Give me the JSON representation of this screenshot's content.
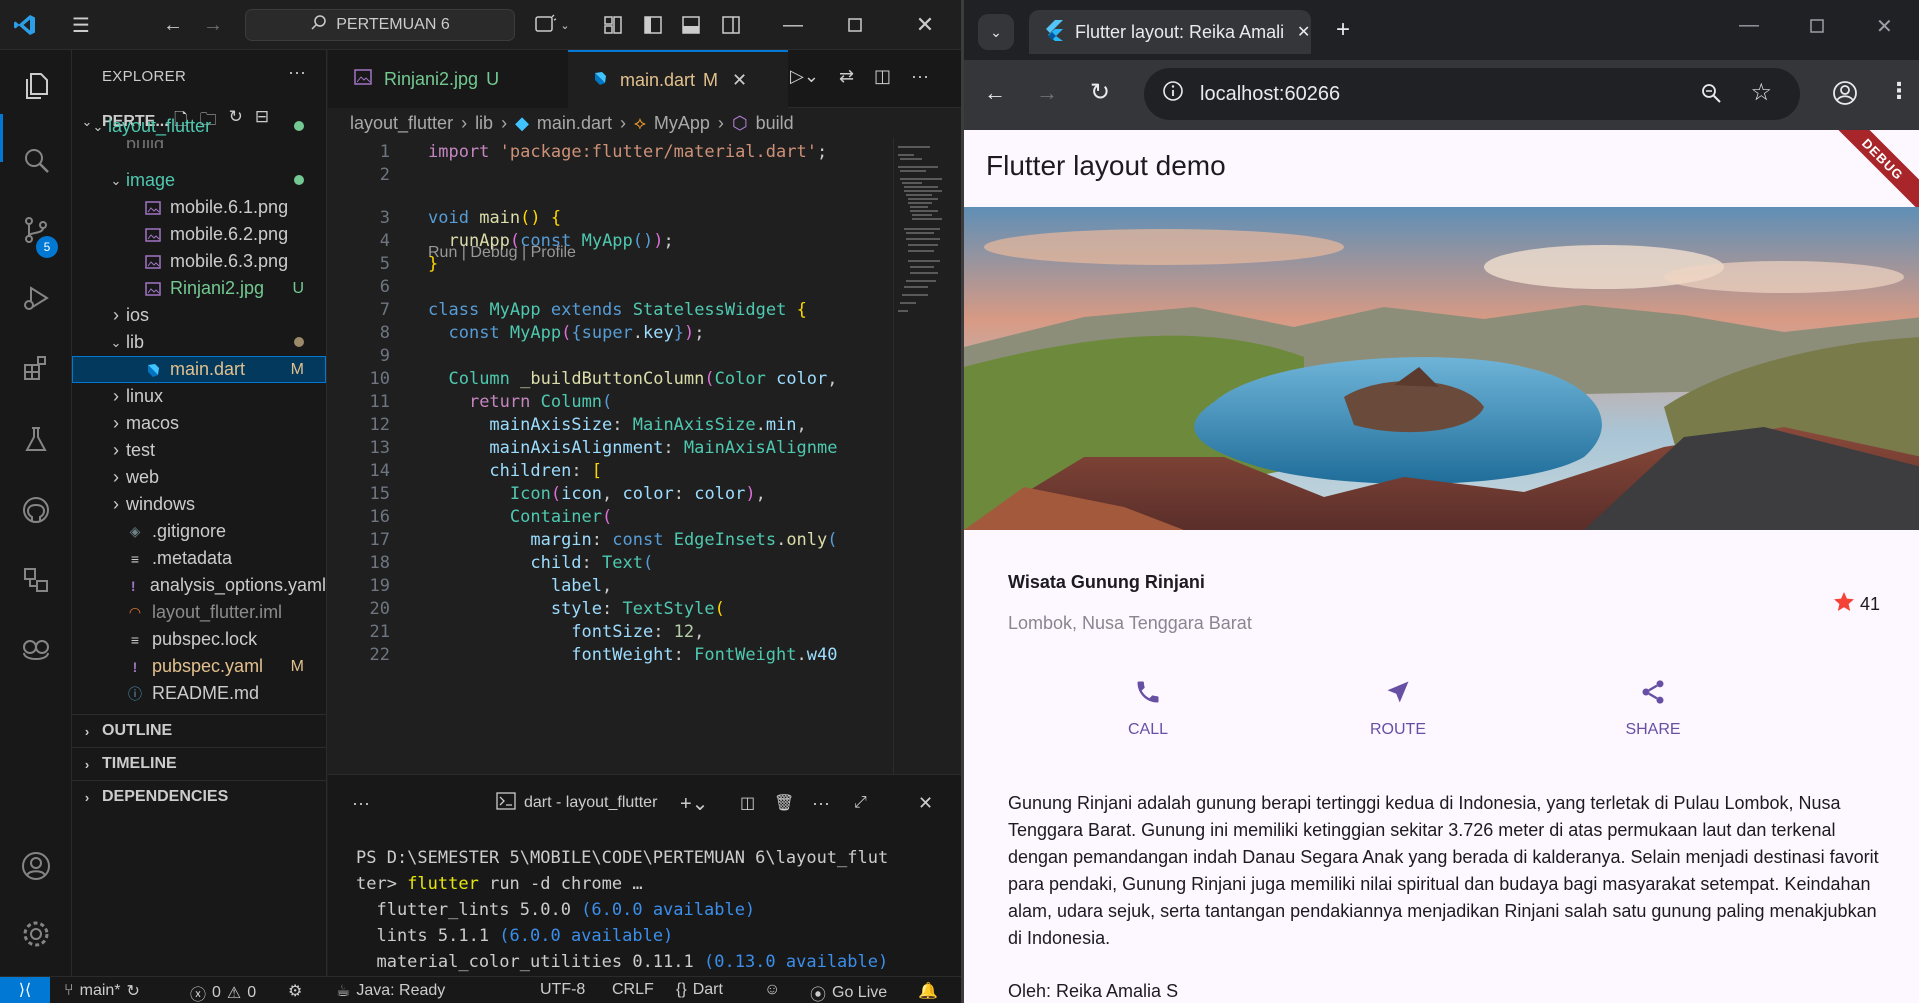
{
  "vscode": {
    "search_text": "PERTEMUAN 6",
    "scm_badge": "5",
    "explorer": {
      "header": "EXPLORER",
      "folder_label": "PERTE...",
      "tree": [
        {
          "label": "layout_flutter",
          "indent": 0,
          "chev": "v",
          "color": "#4ec9b0",
          "status": "dot-green"
        },
        {
          "label": "build",
          "indent": 1,
          "chev": "",
          "color": "#cccccc",
          "status": ""
        },
        {
          "label": "image",
          "indent": 1,
          "chev": "v",
          "color": "#4ec9b0",
          "status": "dot-green"
        },
        {
          "label": "mobile.6.1.png",
          "indent": 2,
          "chev": "",
          "color": "#cccccc",
          "status": "",
          "icon": "image-icon"
        },
        {
          "label": "mobile.6.2.png",
          "indent": 2,
          "chev": "",
          "color": "#cccccc",
          "status": "",
          "icon": "image-icon"
        },
        {
          "label": "mobile.6.3.png",
          "indent": 2,
          "chev": "",
          "color": "#cccccc",
          "status": "",
          "icon": "image-icon"
        },
        {
          "label": "Rinjani2.jpg",
          "indent": 2,
          "chev": "",
          "color": "#73c991",
          "status": "U",
          "icon": "image-icon"
        },
        {
          "label": "ios",
          "indent": 1,
          "chev": ">",
          "color": "#cccccc",
          "status": ""
        },
        {
          "label": "lib",
          "indent": 1,
          "chev": "v",
          "color": "#cccccc",
          "status": "dot-grey"
        },
        {
          "label": "main.dart",
          "indent": 2,
          "chev": "",
          "color": "#e2c08d",
          "status": "M",
          "icon": "dart-icon",
          "selected": true
        },
        {
          "label": "linux",
          "indent": 1,
          "chev": ">",
          "color": "#cccccc",
          "status": ""
        },
        {
          "label": "macos",
          "indent": 1,
          "chev": ">",
          "color": "#cccccc",
          "status": ""
        },
        {
          "label": "test",
          "indent": 1,
          "chev": ">",
          "color": "#cccccc",
          "status": ""
        },
        {
          "label": "web",
          "indent": 1,
          "chev": ">",
          "color": "#cccccc",
          "status": ""
        },
        {
          "label": "windows",
          "indent": 1,
          "chev": ">",
          "color": "#cccccc",
          "status": ""
        },
        {
          "label": ".gitignore",
          "indent": 1,
          "chev": "",
          "color": "#cccccc",
          "status": "",
          "icon": "git-icon"
        },
        {
          "label": ".metadata",
          "indent": 1,
          "chev": "",
          "color": "#cccccc",
          "status": "",
          "icon": "lines-icon"
        },
        {
          "label": "analysis_options.yaml",
          "indent": 1,
          "chev": "",
          "color": "#cccccc",
          "status": "",
          "icon": "yaml-icon"
        },
        {
          "label": "layout_flutter.iml",
          "indent": 1,
          "chev": "",
          "color": "#8c8c8c",
          "status": "",
          "icon": "rss-icon"
        },
        {
          "label": "pubspec.lock",
          "indent": 1,
          "chev": "",
          "color": "#cccccc",
          "status": "",
          "icon": "lines-icon"
        },
        {
          "label": "pubspec.yaml",
          "indent": 1,
          "chev": "",
          "color": "#e2c08d",
          "status": "M",
          "icon": "yaml-icon"
        },
        {
          "label": "README.md",
          "indent": 1,
          "chev": "",
          "color": "#cccccc",
          "status": "",
          "icon": "info-icon"
        }
      ],
      "sections": [
        "OUTLINE",
        "TIMELINE",
        "DEPENDENCIES"
      ]
    },
    "tabs": [
      {
        "label": "Rinjani2.jpg",
        "suffix": "U",
        "active": false
      },
      {
        "label": "main.dart",
        "suffix": "M",
        "active": true
      }
    ],
    "breadcrumb": [
      "layout_flutter",
      "lib",
      "main.dart",
      "MyApp",
      "build"
    ],
    "codelens": "Run | Debug | Profile",
    "line_numbers": [
      "1",
      "2",
      "3",
      "4",
      "5",
      "6",
      "7",
      "8",
      "9",
      "10",
      "11",
      "12",
      "13",
      "14",
      "15",
      "16",
      "17",
      "18",
      "19",
      "20",
      "21",
      "22"
    ],
    "terminal": {
      "title": "dart - layout_flutter",
      "prompt_line1": "PS D:\\SEMESTER 5\\MOBILE\\CODE\\PERTEMUAN 6\\layout_flut",
      "prompt_line2_prefix": "ter> ",
      "cmd": "flutter",
      "cmd_args": " run -d chrome …",
      "deps": [
        {
          "name": "  flutter_lints 5.0.0 ",
          "avail": "(6.0.0 available)"
        },
        {
          "name": "  lints 5.1.1 ",
          "avail": "(6.0.0 available)"
        },
        {
          "name": "  material_color_utilities 0.11.1 ",
          "avail": "(0.13.0 available)"
        }
      ]
    },
    "statusbar": {
      "branch": "main*",
      "errors": "0",
      "warnings": "0",
      "java": "Java: Ready",
      "encoding": "UTF-8",
      "eol": "CRLF",
      "lang": "Dart",
      "golive": "Go Live"
    }
  },
  "chrome": {
    "tab_title": "Flutter layout: Reika Amalia S - ...",
    "url": "localhost:60266",
    "app": {
      "title": "Flutter layout demo",
      "debug_label": "DEBUG",
      "place_name": "Wisata Gunung Rinjani",
      "place_location": "Lombok, Nusa Tenggara Barat",
      "rating": "41",
      "buttons": [
        "CALL",
        "ROUTE",
        "SHARE"
      ],
      "description": "Gunung Rinjani adalah gunung berapi tertinggi kedua di Indonesia, yang terletak di Pulau Lombok, Nusa Tenggara Barat. Gunung ini memiliki ketinggian sekitar 3.726 meter di atas permukaan laut dan terkenal dengan pemandangan indah Danau Segara Anak yang berada di kalderanya. Selain menjadi destinasi favorit para pendaki, Gunung Rinjani juga memiliki nilai spiritual dan budaya bagi masyarakat setempat. Keindahan alam, udara sejuk, serta tantangan pendakiannya menjadikan Rinjani salah satu gunung paling menakjubkan di Indonesia.",
      "author": "Oleh: Reika Amalia S"
    }
  }
}
